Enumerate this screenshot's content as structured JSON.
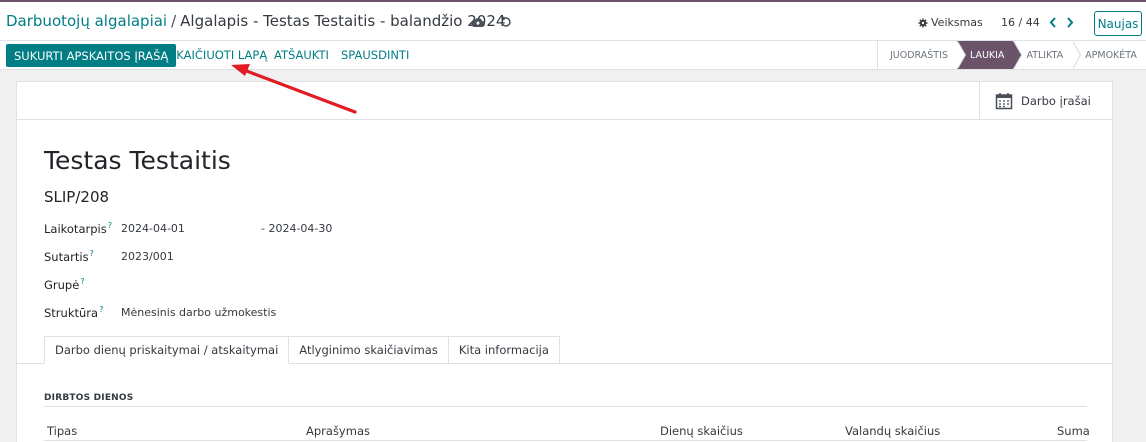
{
  "breadcrumb": {
    "parent": "Darbuotojų algalapiai",
    "separator": "/",
    "current": "Algalapis - Testas Testaitis - balandžio 2024"
  },
  "header": {
    "actions_label": "Veiksmas",
    "pager": "16 / 44",
    "new_label": "Naujas"
  },
  "toolbar": {
    "create_entry": "SUKURTI APSKAITOS ĮRAŠĄ",
    "compute_sheet": "SKAIČIUOTI LAPĄ",
    "cancel": "ATŠAUKTI",
    "print": "SPAUSDINTI"
  },
  "statusbar": {
    "stages": [
      "JUODRAŠTIS",
      "LAUKIA",
      "ATLIKTA",
      "APMOKĖTA"
    ],
    "active": "LAUKIA"
  },
  "smart_button": {
    "label": "Darbo įrašai"
  },
  "form": {
    "name": "Testas Testaitis",
    "reference": "SLIP/208",
    "period_label": "Laikotarpis",
    "date_from": "2024-04-01",
    "date_to": "- 2024-04-30",
    "contract_label": "Sutartis",
    "contract": "2023/001",
    "group_label": "Grupė",
    "structure_label": "Struktūra",
    "structure": "Mėnesinis darbo užmokestis",
    "help_mark": "?"
  },
  "tabs": [
    "Darbo dienų priskaitymai / atskaitymai",
    "Atlyginimo skaičiavimas",
    "Kita informacija"
  ],
  "worked_days": {
    "section_title": "DIRBTOS DIENOS",
    "columns": [
      "Tipas",
      "Aprašymas",
      "Dienų skaičius",
      "Valandų skaičius",
      "Suma"
    ]
  },
  "colors": {
    "brand": "#017e84",
    "status_active": "#6b5369",
    "annotation_arrow": "#e31b23"
  },
  "icons": {
    "save": "cloud-upload-icon",
    "discard": "undo-icon",
    "gear": "gear-icon",
    "calendar": "calendar-icon"
  }
}
